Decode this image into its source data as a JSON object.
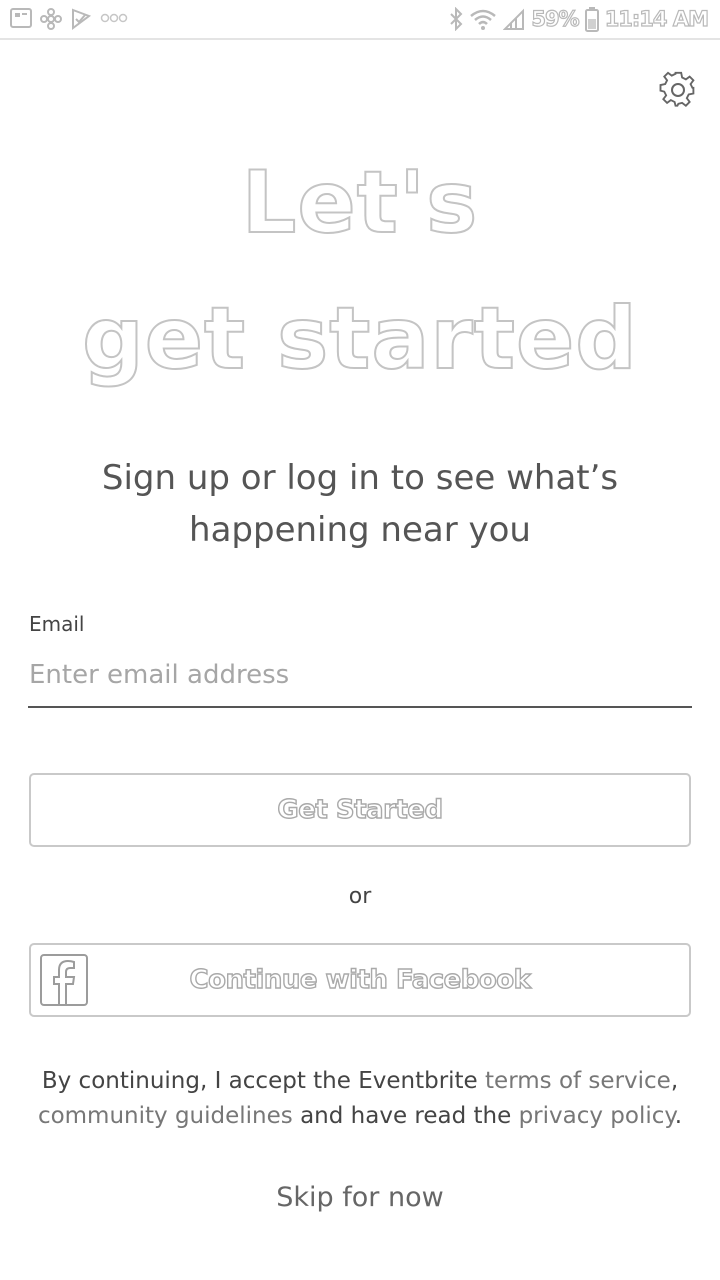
{
  "status_bar": {
    "battery_percent": "59%",
    "time": "11:14 AM",
    "left_icons": [
      "gallery-icon",
      "pinwheel-icon",
      "checkmark-icon",
      "more-dots-icon"
    ],
    "right_icons": [
      "bluetooth-icon",
      "wifi-icon",
      "signal-icon",
      "battery-icon"
    ]
  },
  "header": {
    "settings_icon": "gear-icon"
  },
  "hero": {
    "line1": "Let's",
    "line2": "get started",
    "subtitle_line1": "Sign up or log in to see what’s",
    "subtitle_line2": "happening near you"
  },
  "email": {
    "label": "Email",
    "placeholder": "Enter email address",
    "value": ""
  },
  "buttons": {
    "get_started": "Get Started",
    "or": "or",
    "facebook": "Continue with Facebook",
    "facebook_icon": "facebook-icon"
  },
  "terms": {
    "prefix": "By continuing, I accept the Eventbrite ",
    "tos_link": "terms of service",
    "comma": ",",
    "guidelines_link": "community guidelines",
    "middle": " and have read the ",
    "privacy_link": "privacy policy",
    "suffix": "."
  },
  "skip": {
    "label": "Skip for now"
  },
  "colors": {
    "outline_text": "#c4c4c4",
    "body_text": "#555555",
    "button_border": "#c9c9c9"
  }
}
